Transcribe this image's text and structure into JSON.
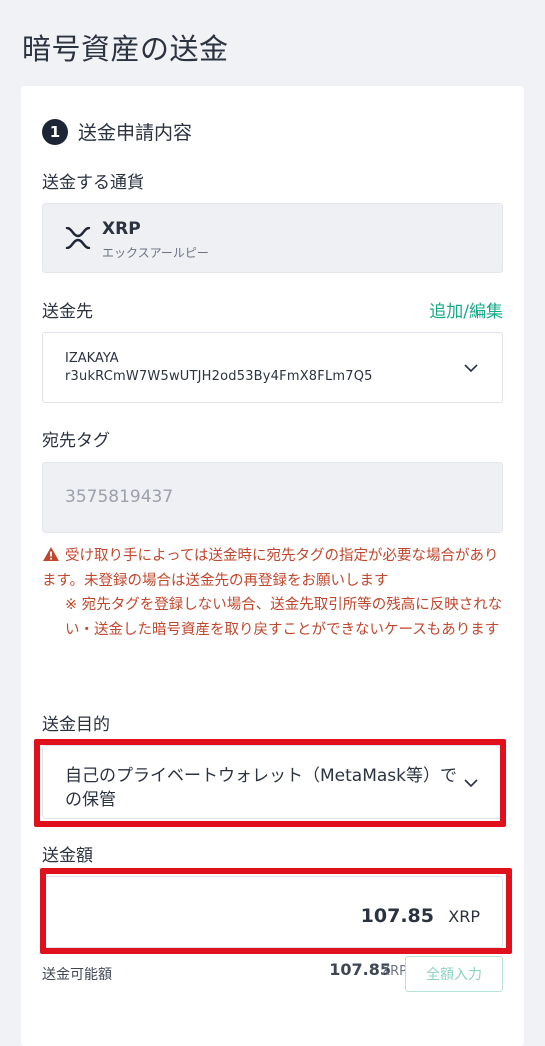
{
  "page": {
    "title": "暗号資産の送金"
  },
  "step": {
    "number": "1",
    "title": "送金申請内容"
  },
  "currency": {
    "label": "送金する通貨",
    "code": "XRP",
    "name": "エックスアールピー",
    "icon": "xrp-icon"
  },
  "destination": {
    "label": "送金先",
    "add_edit_link": "追加/編集",
    "name": "IZAKAYA",
    "address": "r3ukRCmW7W5wUTJH2od53By4FmX8FLm7Q5"
  },
  "dest_tag": {
    "label": "宛先タグ",
    "value": "3575819437"
  },
  "warning": {
    "line1": "受け取り手によっては送金時に宛先タグの指定が必要な場合があります。未登録の場合は送金先の再登録をお願いします",
    "line2": "※ 宛先タグを登録しない場合、送金先取引所等の残高に反映されない・送金した暗号資産を取り戻すことができないケースもあります"
  },
  "purpose": {
    "label": "送金目的",
    "selected": "自己のプライベートウォレット（MetaMask等）での保管"
  },
  "amount": {
    "label": "送金額",
    "value": "107.85",
    "unit": "XRP"
  },
  "available": {
    "label": "送金可能額",
    "value": "107.85",
    "unit": "XRP",
    "fill_all_button": "全額入力"
  },
  "colors": {
    "accent": "#19a98a",
    "warning": "#c0472d",
    "highlight": "#e0101c",
    "step_badge": "#1e2536"
  }
}
